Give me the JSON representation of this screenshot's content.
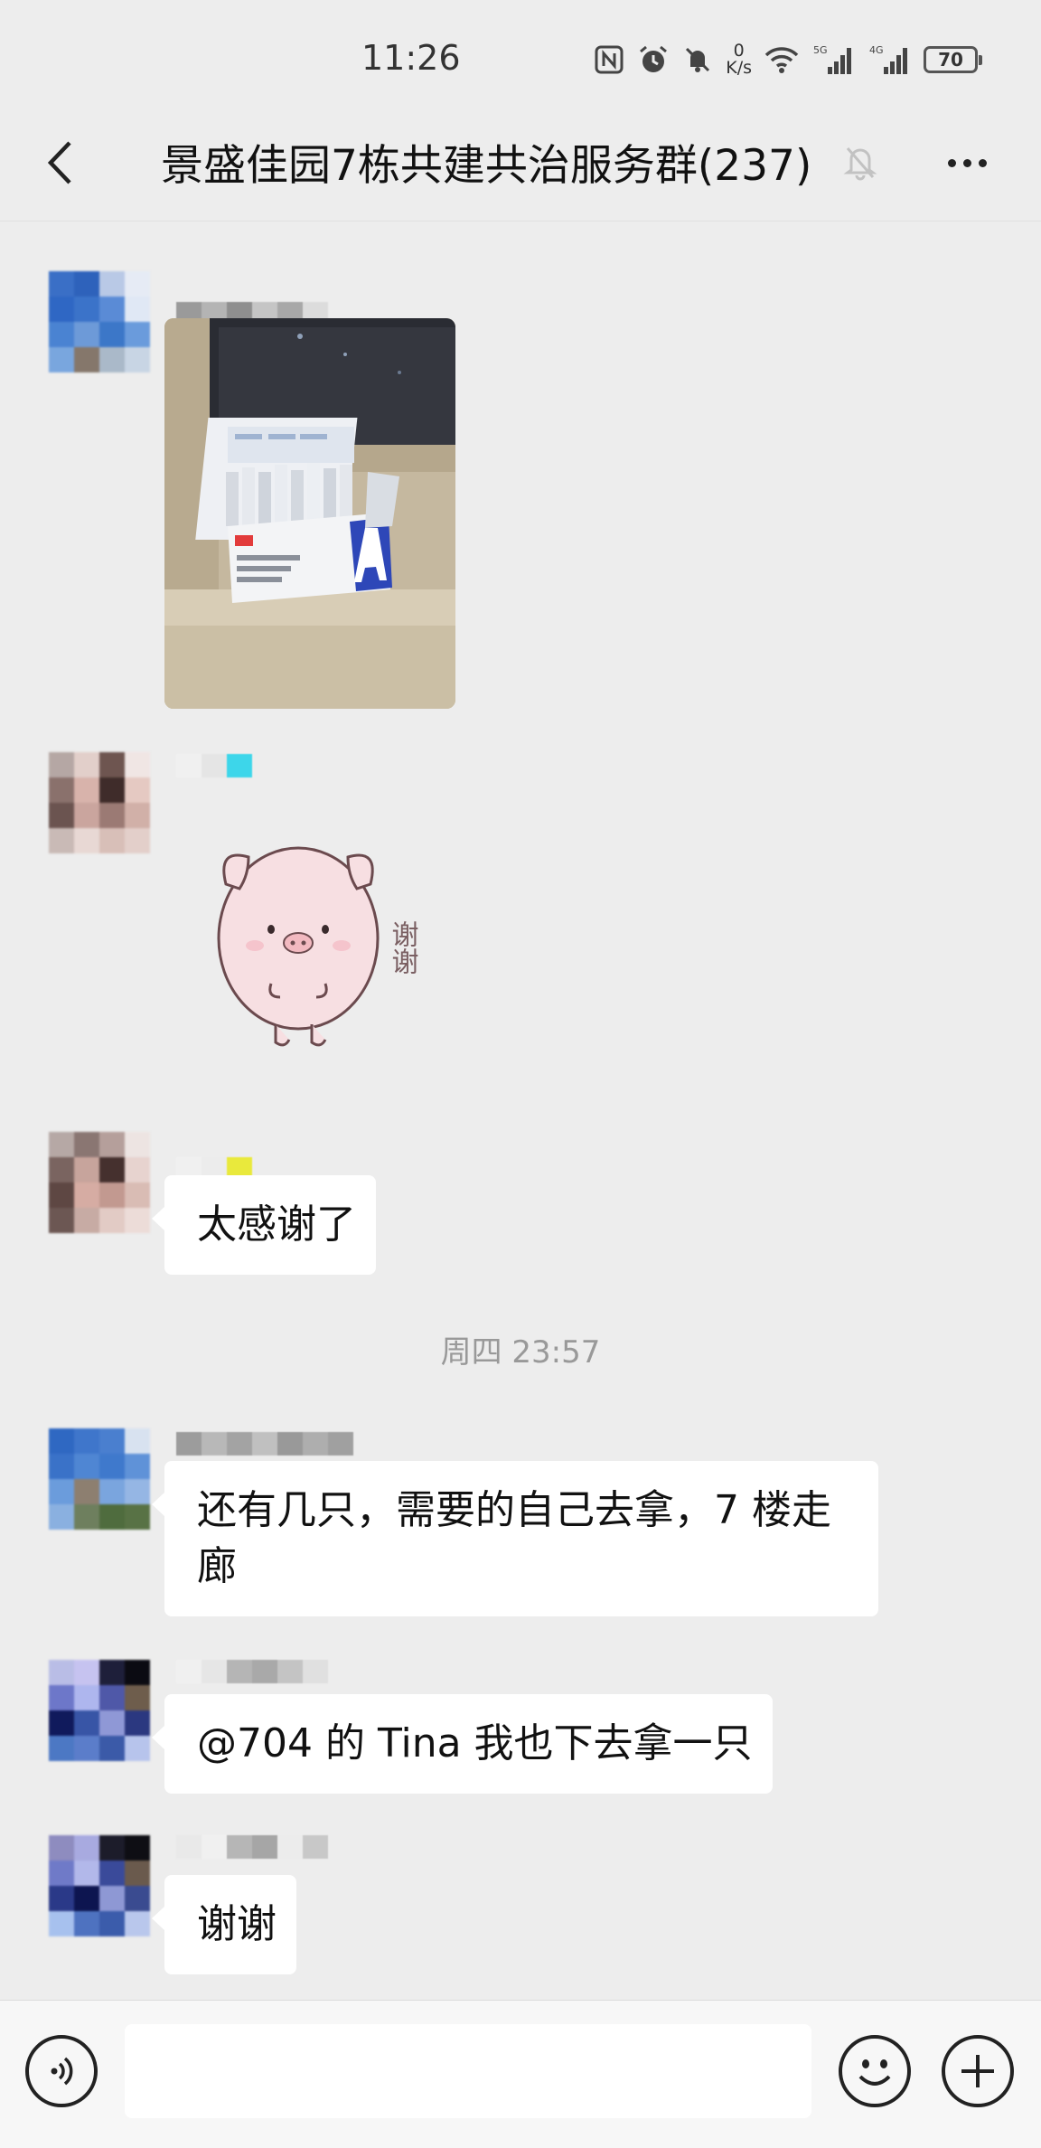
{
  "status_bar": {
    "time": "11:26",
    "net_speed_value": "0",
    "net_speed_unit": "K/s",
    "battery": "70",
    "signal_1_label": "5G",
    "signal_2_label": "4G"
  },
  "header": {
    "title": "景盛佳园7栋共建共治服务群(237)",
    "icons": [
      "back-arrow-icon",
      "muted-bell-icon",
      "more-dots-icon"
    ]
  },
  "messages": [
    {
      "type": "image",
      "content": "photo of a box of antigen test kits on a window sill"
    },
    {
      "type": "sticker",
      "sticker_text": "谢谢"
    },
    {
      "type": "text",
      "text": "太感谢了"
    },
    {
      "type": "text",
      "text": "还有几只，需要的自己去拿，7 楼走廊"
    },
    {
      "type": "text",
      "text": "@704 的 Tina  我也下去拿一只"
    },
    {
      "type": "text",
      "text": "谢谢"
    }
  ],
  "timestamp": "周四 23:57",
  "input_bar": {
    "placeholder": "",
    "icons": [
      "voice-icon",
      "emoji-icon",
      "plus-icon"
    ]
  },
  "colors": {
    "background": "#ededed",
    "bubble": "#ffffff",
    "timestamp": "#999999"
  }
}
